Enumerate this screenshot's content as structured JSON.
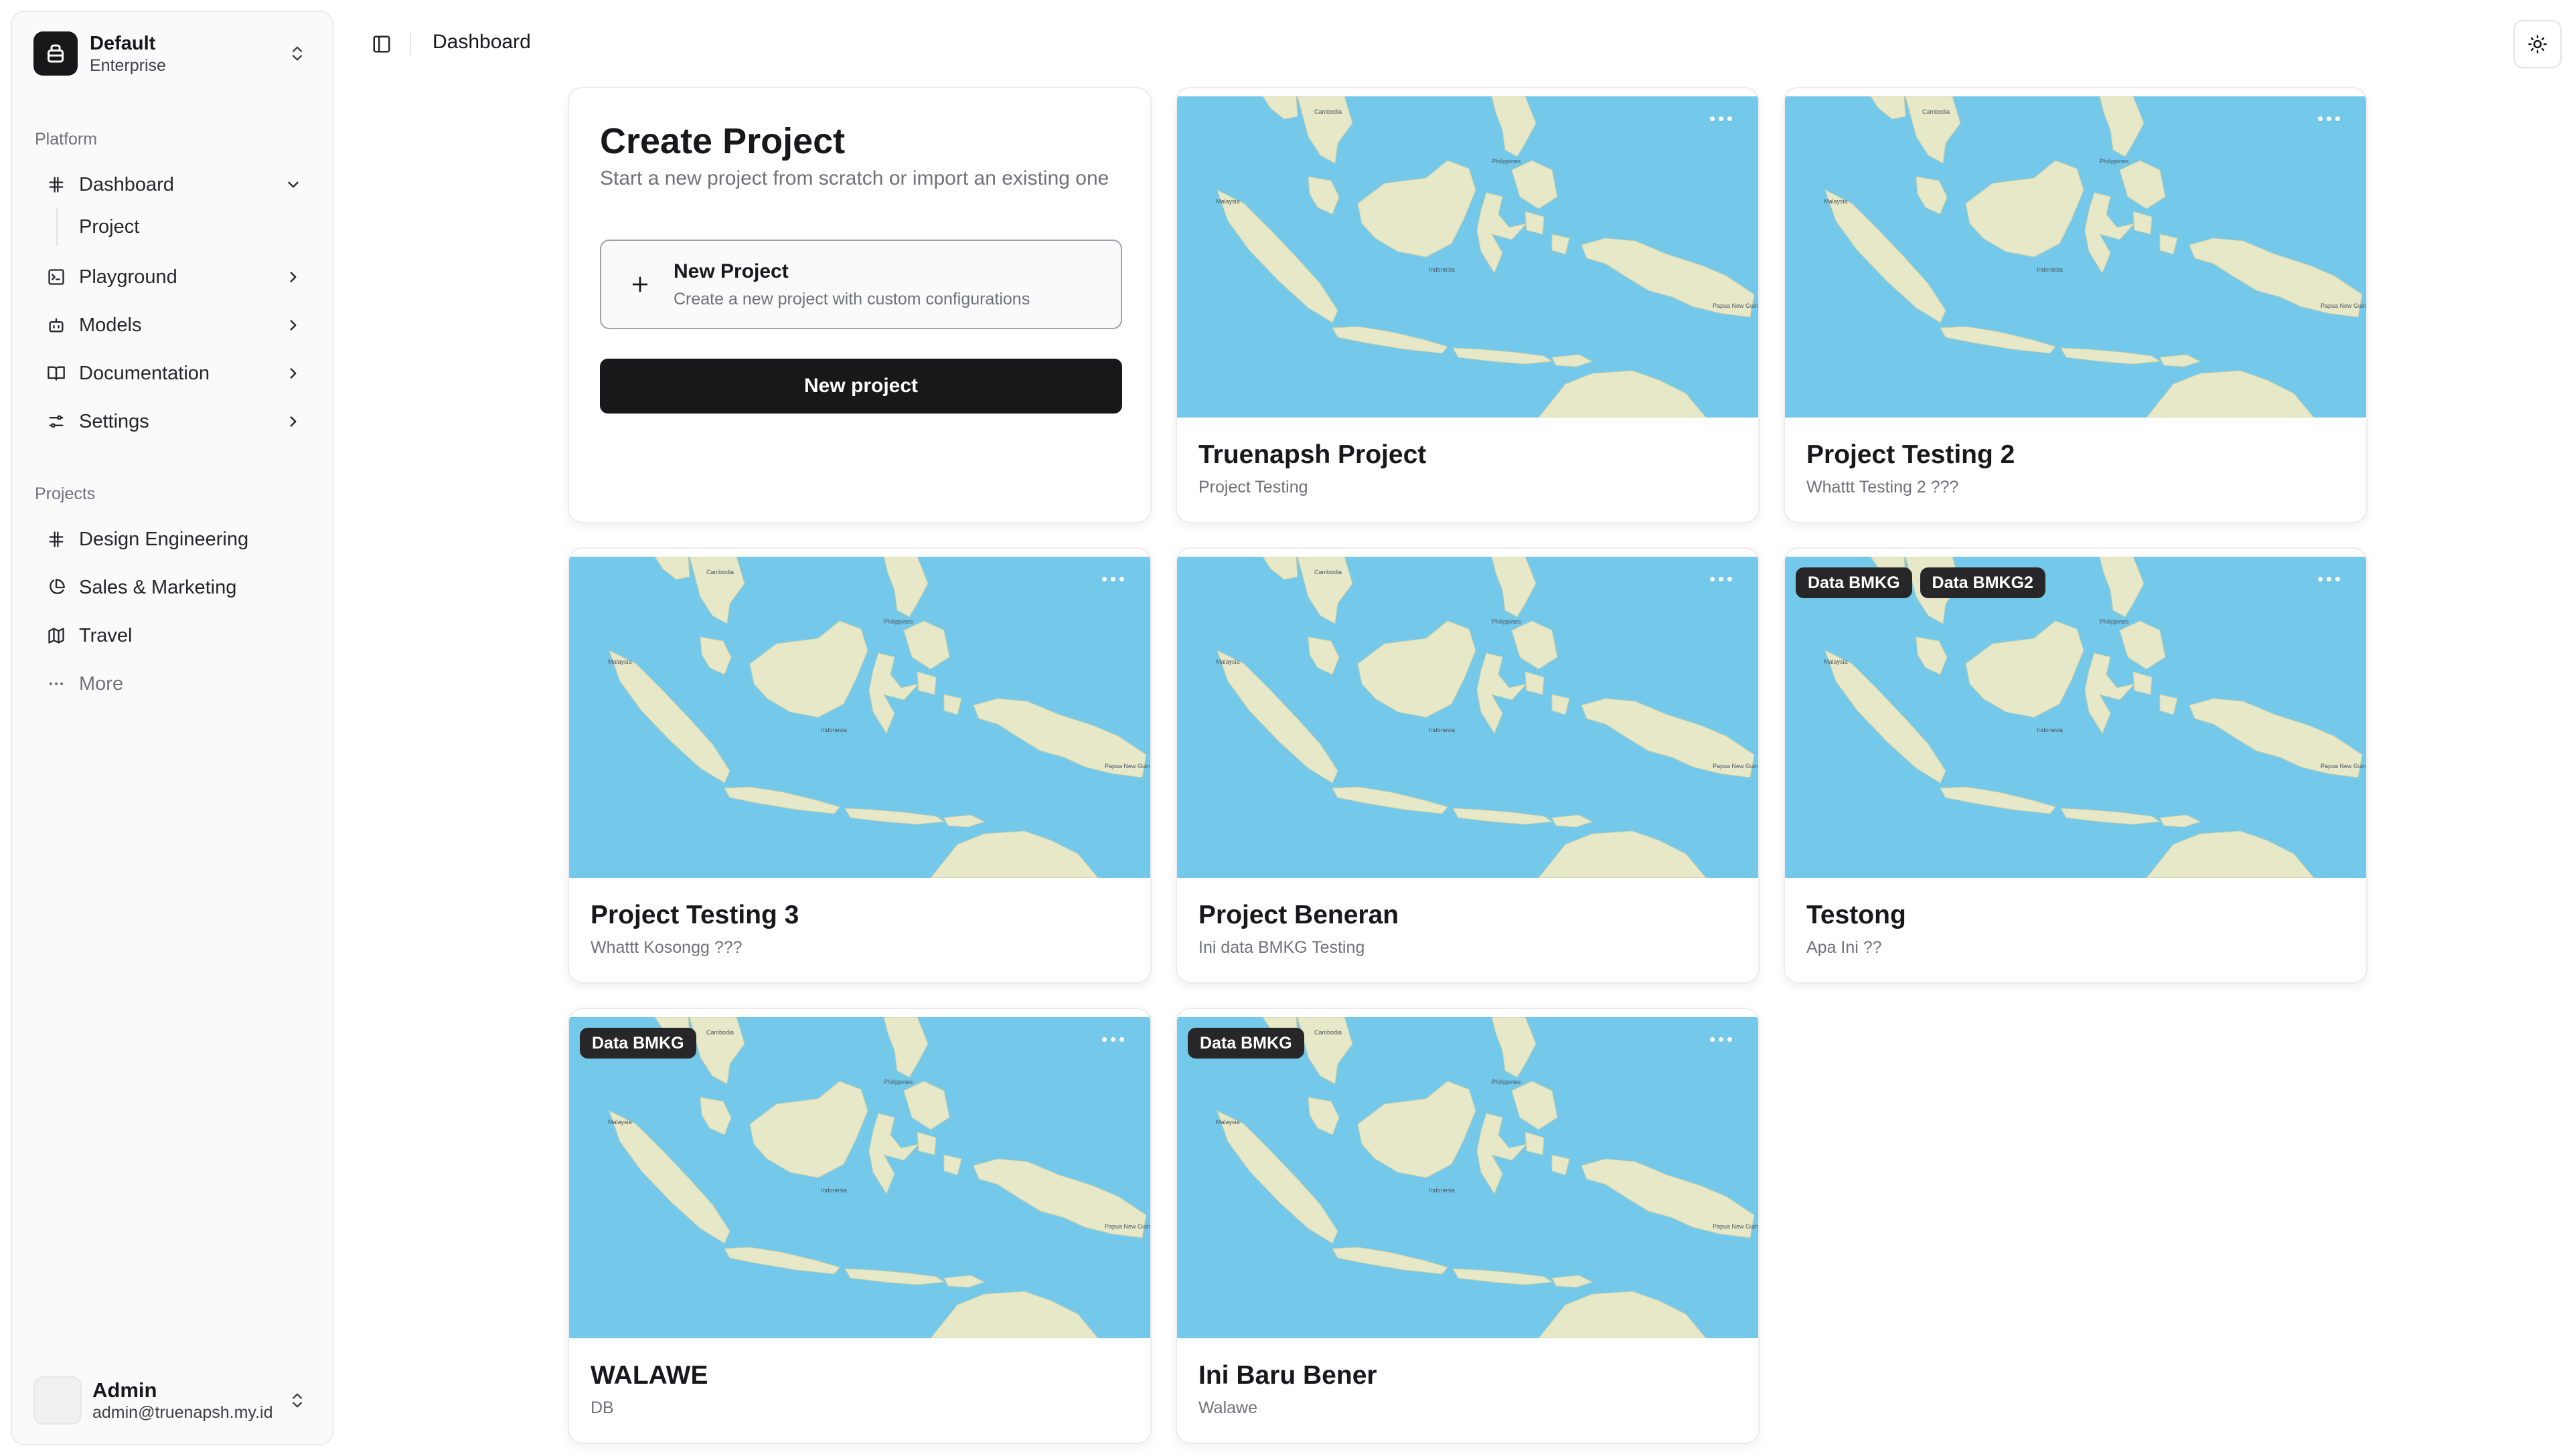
{
  "team": {
    "name": "Default",
    "plan": "Enterprise"
  },
  "sidebar": {
    "platform_label": "Platform",
    "nav": [
      {
        "label": "Dashboard",
        "icon": "hash-icon"
      },
      {
        "label": "Playground",
        "icon": "terminal-icon"
      },
      {
        "label": "Models",
        "icon": "bot-icon"
      },
      {
        "label": "Documentation",
        "icon": "book-icon"
      },
      {
        "label": "Settings",
        "icon": "settings-icon"
      }
    ],
    "sub_item": "Project",
    "projects_label": "Projects",
    "projects": [
      {
        "label": "Design Engineering",
        "icon": "frame-icon"
      },
      {
        "label": "Sales & Marketing",
        "icon": "pie-chart-icon"
      },
      {
        "label": "Travel",
        "icon": "map-icon"
      }
    ],
    "more_label": "More"
  },
  "user": {
    "name": "Admin",
    "email": "admin@truenapsh.my.id"
  },
  "header": {
    "breadcrumb": "Dashboard"
  },
  "create": {
    "title": "Create Project",
    "subtitle": "Start a new project from scratch or import an existing one",
    "option_title": "New Project",
    "option_desc": "Create a new project with custom configurations",
    "button_label": "New project"
  },
  "projects": [
    {
      "title": "Truenapsh Project",
      "subtitle": "Project Testing",
      "badges": []
    },
    {
      "title": "Project Testing 2",
      "subtitle": "Whattt Testing 2 ???",
      "badges": []
    },
    {
      "title": "Project Testing 3",
      "subtitle": "Whattt Kosongg ???",
      "badges": []
    },
    {
      "title": "Project Beneran",
      "subtitle": "Ini data BMKG Testing",
      "badges": []
    },
    {
      "title": "Testong",
      "subtitle": "Apa Ini ??",
      "badges": [
        "Data BMKG",
        "Data BMKG2"
      ]
    },
    {
      "title": "WALAWE",
      "subtitle": "DB",
      "badges": [
        "Data BMKG"
      ]
    },
    {
      "title": "Ini Baru Bener",
      "subtitle": "Walawe",
      "badges": [
        "Data BMKG"
      ]
    }
  ],
  "map_labels": [
    "Cambodia",
    "Philippines",
    "Malaysia",
    "Indonesia",
    "Papua New Guinea"
  ],
  "colors": {
    "sea": "#74c9ea",
    "land": "#e6e8c8",
    "primary": "#18181b"
  }
}
